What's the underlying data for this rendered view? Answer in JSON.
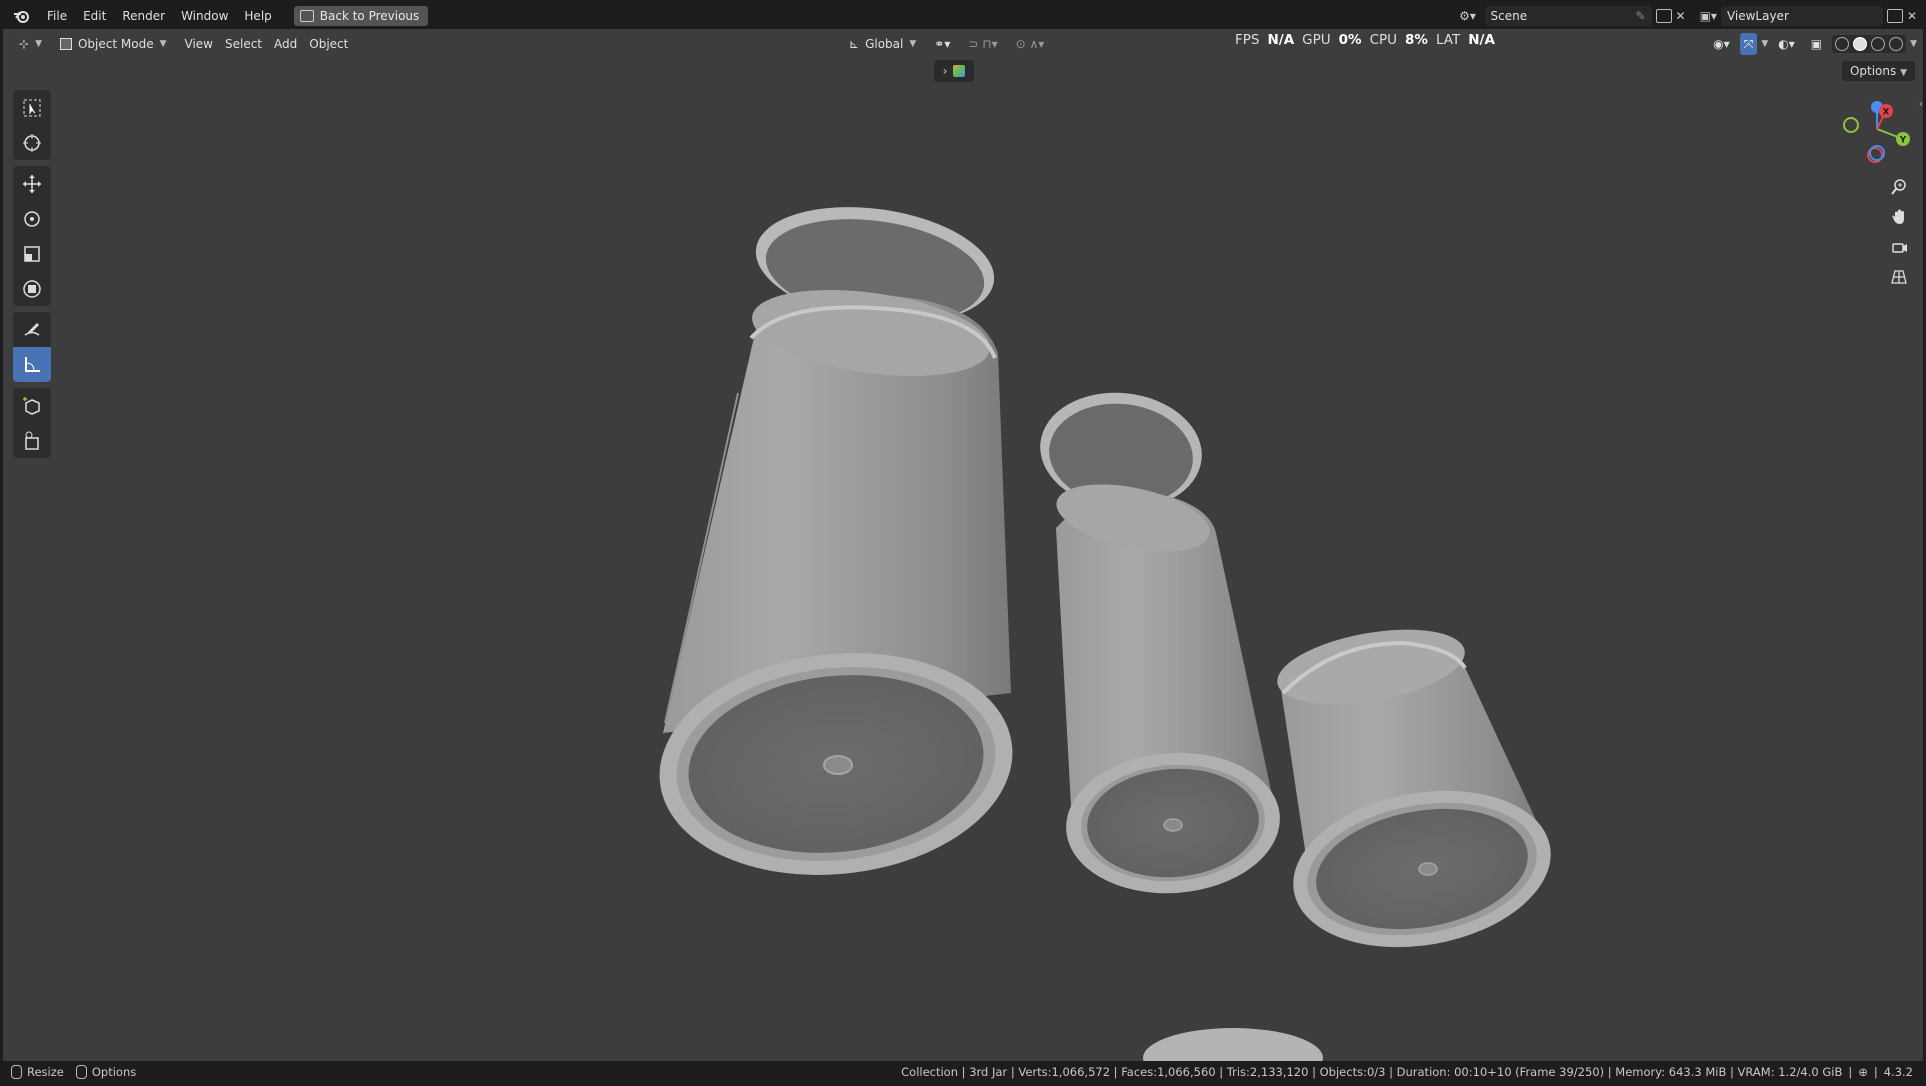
{
  "menu": {
    "items": [
      "File",
      "Edit",
      "Render",
      "Window",
      "Help"
    ],
    "back_button": "Back to Previous"
  },
  "scene_selector": {
    "value": "Scene"
  },
  "view_layer_selector": {
    "value": "ViewLayer"
  },
  "viewport_header": {
    "mode": "Object Mode",
    "menus": [
      "View",
      "Select",
      "Add",
      "Object"
    ],
    "transform_orientation": "Global",
    "options_label": "Options"
  },
  "perf": {
    "fps_label": "FPS",
    "fps_value": "N/A",
    "gpu_label": "GPU",
    "gpu_value": "0%",
    "cpu_label": "CPU",
    "cpu_value": "8%",
    "lat_label": "LAT",
    "lat_value": "N/A"
  },
  "gizmo": {
    "x_label": "X",
    "y_label": "Y"
  },
  "tools": [
    "select-box",
    "cursor",
    "move",
    "rotate",
    "scale",
    "transform",
    "annotate",
    "measure",
    "add-cube",
    "extrude"
  ],
  "status_bar": {
    "left_items": [
      "Resize",
      "Options"
    ],
    "info": "Collection | 3rd Jar | Verts:1,066,572 | Faces:1,066,560 | Tris:2,133,120 | Objects:0/3 | Duration: 00:10+10 (Frame 39/250) | Memory: 643.3 MiB | VRAM: 1.2/4.0 GiB",
    "version": "4.3.2"
  },
  "colors": {
    "viewport_bg": "#3d3d3d",
    "active_tool": "#4772b3",
    "axis_x": "#e6424f",
    "axis_y": "#8bc53f",
    "axis_z": "#4a8df0"
  }
}
